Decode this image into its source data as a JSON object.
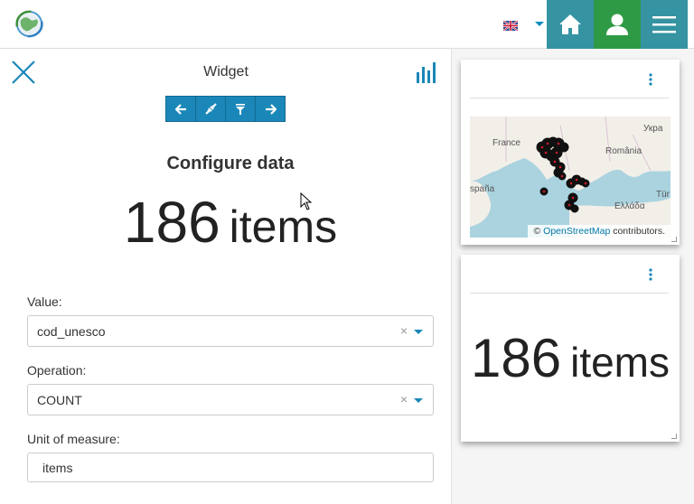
{
  "header": {
    "logo_icon": "globe-logo-icon",
    "language_icon": "uk-flag-icon",
    "home_icon": "home-icon",
    "user_icon": "user-icon",
    "menu_icon": "hamburger-menu-icon"
  },
  "panel": {
    "title": "Widget",
    "close_icon": "close-icon",
    "chart_icon": "bar-chart-icon",
    "toolbar": [
      {
        "icon": "arrow-left-icon"
      },
      {
        "icon": "connect-plug-icon"
      },
      {
        "icon": "filter-icon"
      },
      {
        "icon": "arrow-right-icon"
      }
    ],
    "heading": "Configure data",
    "count": "186",
    "unit": "items",
    "value_label": "Value:",
    "value": "cod_unesco",
    "operation_label": "Operation:",
    "operation": "COUNT",
    "uom_label": "Unit of measure:",
    "uom": "items",
    "clear_symbol": "×"
  },
  "map_card": {
    "labels": [
      "France",
      "România",
      "Укра",
      "spaña",
      "Ελλάδα",
      "Tür"
    ],
    "attribution_prefix": "©",
    "attribution_link": "OpenStreetMap",
    "attribution_suffix": "contributors."
  },
  "counter_card": {
    "count": "186",
    "unit": "items"
  },
  "colors": {
    "teal": "#3593a2",
    "green": "#2f9a45",
    "blue": "#1a87b8"
  }
}
